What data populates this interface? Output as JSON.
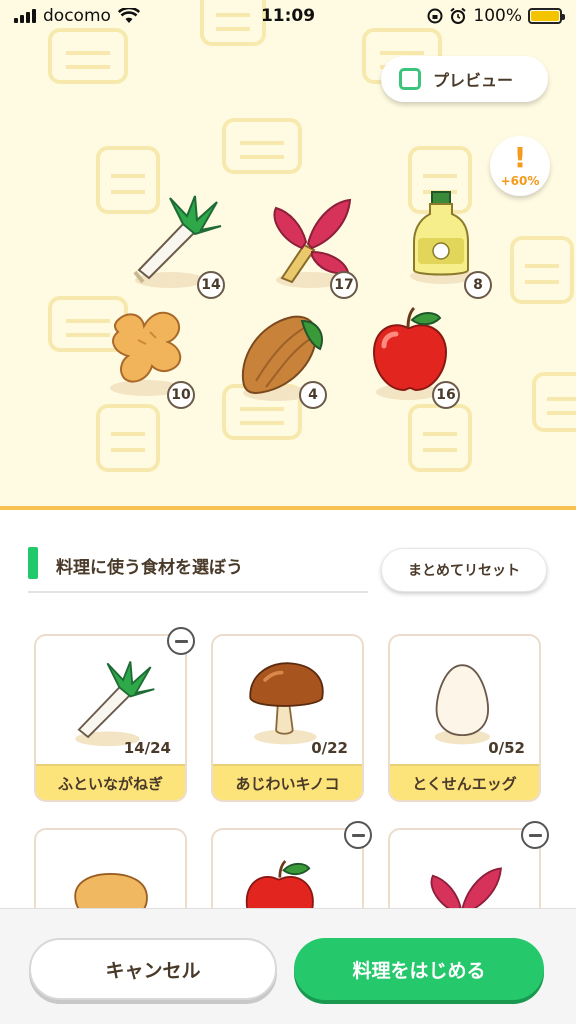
{
  "status_bar": {
    "carrier": "docomo",
    "time": "11:09",
    "battery": "100%"
  },
  "preview": {
    "checkbox_label": "プレビュー",
    "bonus_mark": "!",
    "bonus_text": "+60%",
    "items": [
      {
        "icon": "leek-icon",
        "qty": "14"
      },
      {
        "icon": "red-leaf-icon",
        "qty": "17"
      },
      {
        "icon": "oil-bottle-icon",
        "qty": "8"
      },
      {
        "icon": "ginger-icon",
        "qty": "10"
      },
      {
        "icon": "cacao-icon",
        "qty": "4"
      },
      {
        "icon": "apple-icon",
        "qty": "16"
      }
    ]
  },
  "section": {
    "title": "料理に使う食材を選ぼう",
    "reset_label": "まとめてリセット"
  },
  "ingredients": [
    {
      "icon": "leek-icon",
      "name": "ふといながねぎ",
      "count": "14/24"
    },
    {
      "icon": "mushroom-icon",
      "name": "あじわいキノコ",
      "count": "0/22"
    },
    {
      "icon": "egg-icon",
      "name": "とくせんエッグ",
      "count": "0/52"
    },
    {
      "icon": "potato-icon",
      "name": "",
      "count": ""
    },
    {
      "icon": "apple-icon",
      "name": "",
      "count": ""
    },
    {
      "icon": "red-leaf-icon",
      "name": "",
      "count": ""
    }
  ],
  "footer": {
    "cancel_label": "キャンセル",
    "start_label": "料理をはじめる"
  },
  "colors": {
    "accent_green": "#25c86b",
    "label_yellow": "#fce47a",
    "preview_bg": "#fffbe2",
    "bonus_orange": "#f59a1c"
  }
}
